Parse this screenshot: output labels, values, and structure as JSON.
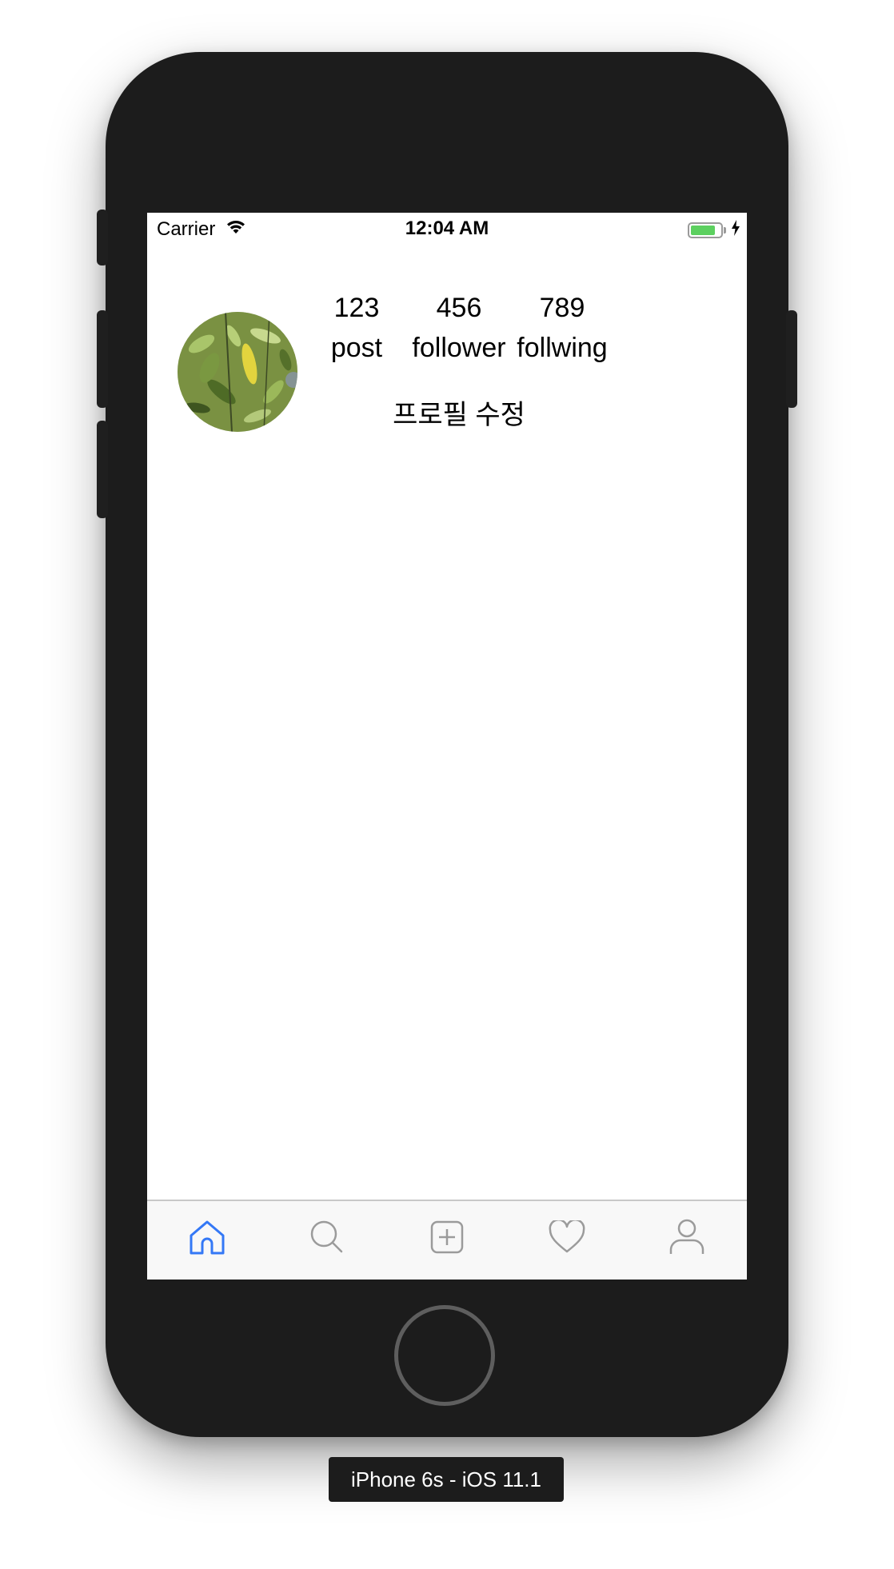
{
  "status_bar": {
    "carrier": "Carrier",
    "time": "12:04 AM",
    "battery_level": 0.85,
    "battery_color": "#5cd05f"
  },
  "profile": {
    "avatar_icon": "leaf-photo",
    "stats": [
      {
        "value": "123",
        "label": "post"
      },
      {
        "value": "456",
        "label": "follower"
      },
      {
        "value": "789",
        "label": "follwing"
      }
    ],
    "edit_label": "프로필 수정"
  },
  "tabbar": {
    "items": [
      {
        "icon": "home-icon",
        "selected": true
      },
      {
        "icon": "search-icon",
        "selected": false
      },
      {
        "icon": "add-post-icon",
        "selected": false
      },
      {
        "icon": "heart-icon",
        "selected": false
      },
      {
        "icon": "profile-icon",
        "selected": false
      }
    ],
    "selected_color": "#3478f6",
    "unselected_color": "#9b9b9b"
  },
  "device": {
    "label": "iPhone 6s - iOS 11.1"
  }
}
